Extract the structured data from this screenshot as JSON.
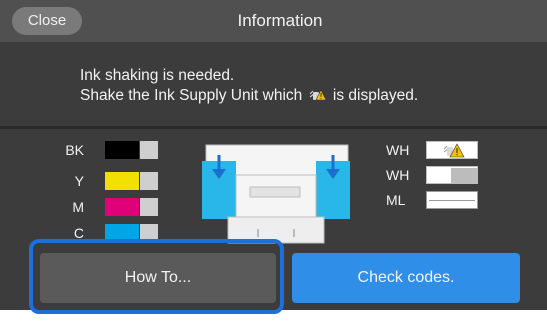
{
  "header": {
    "close_label": "Close",
    "title": "Information"
  },
  "message": {
    "line1": "Ink shaking is needed.",
    "line2_before": "Shake the Ink Supply Unit which",
    "line2_after": "is displayed.",
    "icon": "ink-shake-warning-icon"
  },
  "inks_left": [
    {
      "label": "BK",
      "color": "#000000"
    },
    {
      "label": "Y",
      "color": "#f2e100"
    },
    {
      "label": "M",
      "color": "#e0007a"
    },
    {
      "label": "C",
      "color": "#00a6e6"
    }
  ],
  "inks_right": [
    {
      "label": "WH",
      "state": "shake-warning",
      "icon": "ink-shake-warning-icon"
    },
    {
      "label": "WH",
      "state": "partial"
    },
    {
      "label": "ML",
      "state": "full"
    }
  ],
  "buttons": {
    "howto_label": "How To...",
    "check_label": "Check codes."
  },
  "colors": {
    "accent": "#2f8fe8",
    "focus_ring": "#1f6fd8",
    "warning": "#f2c200",
    "printer_ink_blue": "#29b6e8"
  }
}
